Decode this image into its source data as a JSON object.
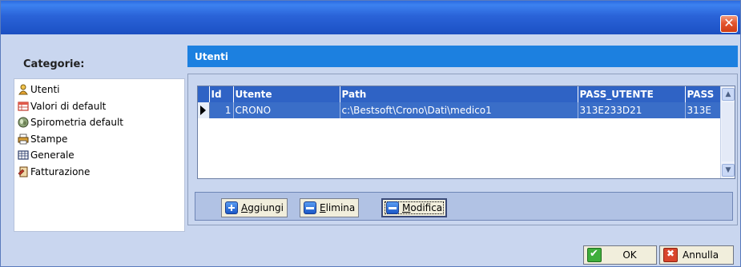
{
  "window": {
    "close_label": "✕"
  },
  "sidebar": {
    "title": "Categorie:",
    "items": [
      {
        "label": "Utenti",
        "icon": "user-icon"
      },
      {
        "label": "Valori di default",
        "icon": "table-icon"
      },
      {
        "label": "Spirometria default",
        "icon": "spirometry-icon"
      },
      {
        "label": "Stampe",
        "icon": "printer-icon"
      },
      {
        "label": "Generale",
        "icon": "grid-icon"
      },
      {
        "label": "Fatturazione",
        "icon": "invoice-icon"
      }
    ]
  },
  "main": {
    "header": "Utenti",
    "grid": {
      "columns": [
        "Id",
        "Utente",
        "Path",
        "PASS_UTENTE",
        "PASS"
      ],
      "rows": [
        [
          "1",
          "CRONO",
          "c:\\Bestsoft\\Crono\\Dati\\medico1",
          "313E233D21",
          "313E"
        ]
      ]
    },
    "buttons": {
      "add_rest": "ggiungi",
      "add_key": "A",
      "delete_rest": "limina",
      "delete_key": "E",
      "edit_rest": "odifica",
      "edit_key": "M"
    }
  },
  "footer": {
    "ok": "OK",
    "cancel": "Annulla"
  },
  "colors": {
    "titlebar": "#2a63d8",
    "header": "#1c80e0",
    "selection": "#3a6ec8",
    "grid_header": "#2f63c5"
  }
}
